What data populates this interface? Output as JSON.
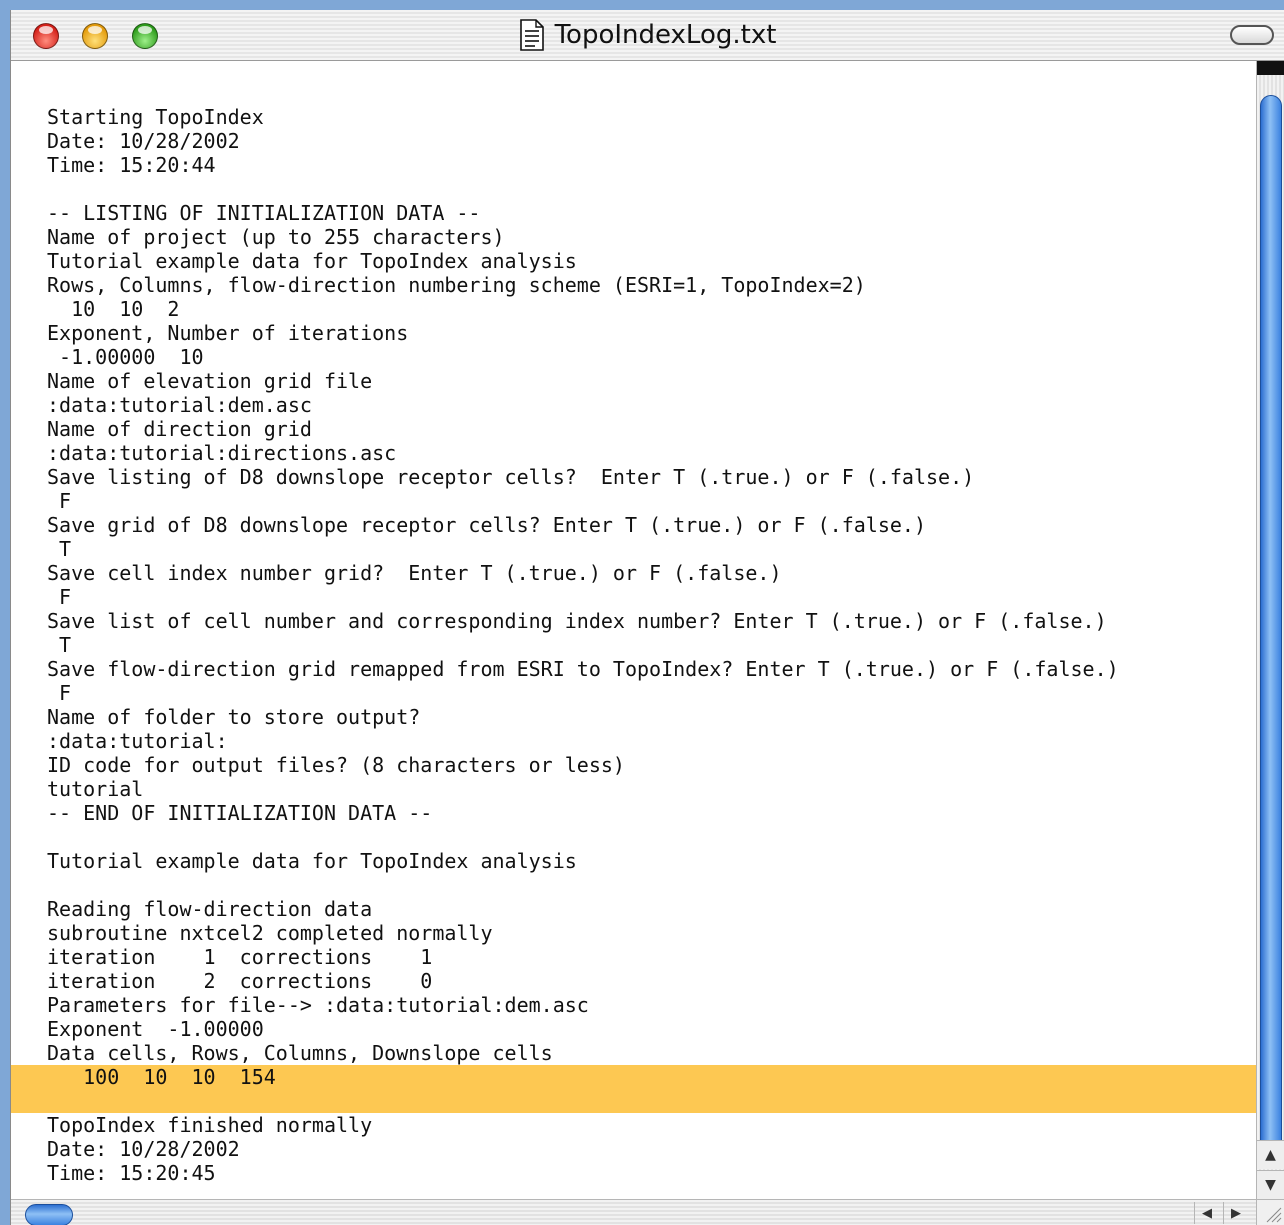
{
  "window": {
    "title": "TopoIndexLog.txt"
  },
  "log_lines": [
    "Starting TopoIndex",
    "Date: 10/28/2002",
    "Time: 15:20:44",
    "",
    "-- LISTING OF INITIALIZATION DATA --",
    "Name of project (up to 255 characters)",
    "Tutorial example data for TopoIndex analysis",
    "Rows, Columns, flow-direction numbering scheme (ESRI=1, TopoIndex=2)",
    "  10  10  2",
    "Exponent, Number of iterations",
    " -1.00000  10",
    "Name of elevation grid file",
    ":data:tutorial:dem.asc",
    "Name of direction grid",
    ":data:tutorial:directions.asc",
    "Save listing of D8 downslope receptor cells?  Enter T (.true.) or F (.false.)",
    " F",
    "Save grid of D8 downslope receptor cells? Enter T (.true.) or F (.false.)",
    " T",
    "Save cell index number grid?  Enter T (.true.) or F (.false.)",
    " F",
    "Save list of cell number and corresponding index number? Enter T (.true.) or F (.false.)",
    " T",
    "Save flow-direction grid remapped from ESRI to TopoIndex? Enter T (.true.) or F (.false.)",
    " F",
    "Name of folder to store output?",
    ":data:tutorial:",
    "ID code for output files? (8 characters or less)",
    "tutorial",
    "-- END OF INITIALIZATION DATA --",
    "",
    "Tutorial example data for TopoIndex analysis",
    "",
    "Reading flow-direction data",
    "subroutine nxtcel2 completed normally",
    "iteration    1  corrections    1",
    "iteration    2  corrections    0",
    "Parameters for file--> :data:tutorial:dem.asc",
    "Exponent  -1.00000",
    "Data cells, Rows, Columns, Downslope cells",
    "   100  10  10  154",
    "",
    "TopoIndex finished normally",
    "Date: 10/28/2002",
    "Time: 15:20:45"
  ],
  "highlight": {
    "color": "#fdc852",
    "line_numbers": [
      40,
      41
    ]
  },
  "colors": {
    "accent": "#3b82e0",
    "close": "#d5211a",
    "minimize": "#e39b0c",
    "zoom": "#2e9c1c"
  },
  "icons": {
    "close": "close-light-icon",
    "minimize": "minimize-light-icon",
    "zoom": "zoom-light-icon",
    "document": "text-document-icon",
    "toolbar": "toolbar-toggle-icon"
  },
  "scrollbars": {
    "up_arrow": "▲",
    "down_arrow": "▼",
    "left_arrow": "◀",
    "right_arrow": "▶"
  }
}
